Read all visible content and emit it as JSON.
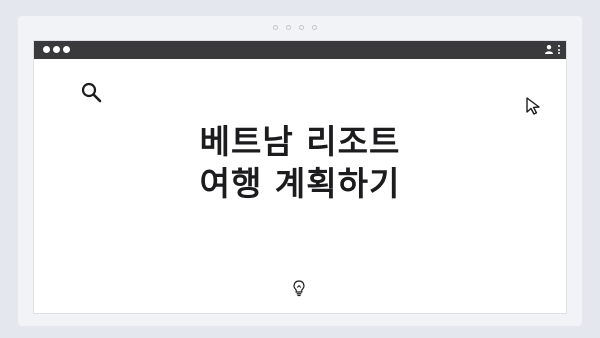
{
  "carousel": {
    "dot_count": 4
  },
  "window": {
    "titlebar_color": "#3a3a3c",
    "controls": [
      "window-dot",
      "window-dot",
      "window-dot"
    ],
    "right_icons": [
      "user-icon",
      "kebab-menu-icon"
    ]
  },
  "slide": {
    "headline_line1": "베트남 리조트",
    "headline_line2": "여행 계획하기",
    "icons": [
      "search-icon",
      "cursor-icon",
      "lightbulb-icon"
    ]
  }
}
